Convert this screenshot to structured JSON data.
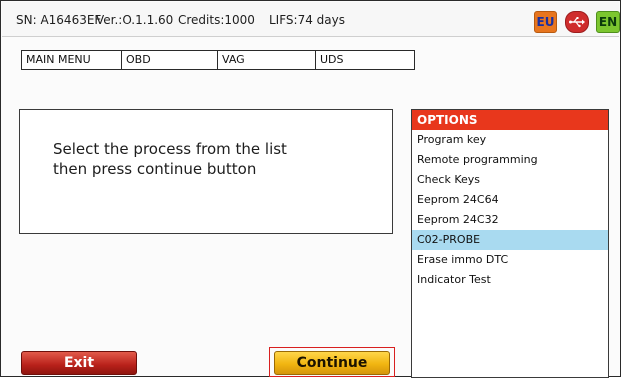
{
  "status": {
    "serial": "SN: A16463EF",
    "version": "Ver.:O.1.1.60",
    "credits": "Credits:1000",
    "lifs": "LIFS:74 days"
  },
  "indicators": {
    "region": "EU",
    "usb_icon": "usb-icon",
    "language": "EN"
  },
  "menu": {
    "tabs": [
      {
        "label": "MAIN MENU"
      },
      {
        "label": "OBD"
      },
      {
        "label": "VAG"
      },
      {
        "label": "UDS"
      }
    ]
  },
  "message": {
    "line1": "Select the process from the list",
    "line2": "then press continue button"
  },
  "options": {
    "header": "OPTIONS",
    "items": [
      {
        "label": "Program key"
      },
      {
        "label": "Remote programming"
      },
      {
        "label": "Check Keys"
      },
      {
        "label": "Eeprom 24C64"
      },
      {
        "label": "Eeprom 24C32"
      },
      {
        "label": "C02-PROBE"
      },
      {
        "label": "Erase immo DTC"
      },
      {
        "label": "Indicator Test"
      }
    ],
    "selected": "C02-PROBE"
  },
  "buttons": {
    "exit": "Exit",
    "continue": "Continue"
  },
  "colors": {
    "options_header": "#e8371c",
    "selected_row": "#a9daf0",
    "exit_button": "#b8211a",
    "continue_button": "#f1b511"
  }
}
